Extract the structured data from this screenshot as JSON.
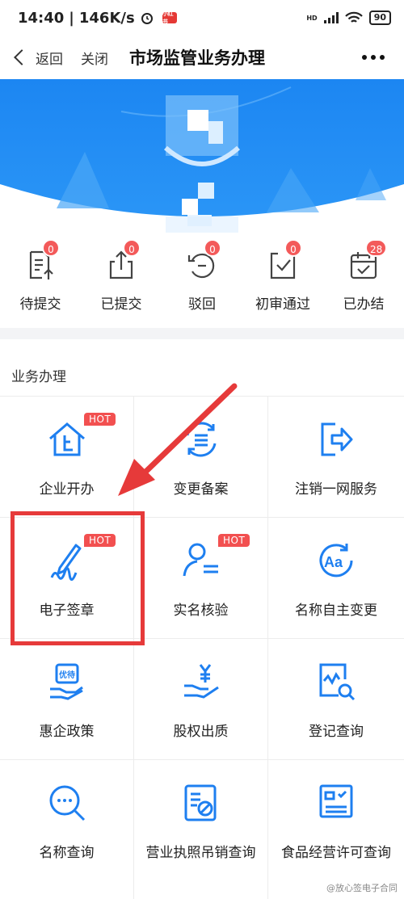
{
  "status_bar": {
    "time": "14:40",
    "network_speed": "146K/s",
    "app_badge": "小红书",
    "battery": "90",
    "signal_label": "HD"
  },
  "nav": {
    "back_label": "返回",
    "close_label": "关闭",
    "title": "市场监管业务办理"
  },
  "status_items": [
    {
      "label": "待提交",
      "count": "0",
      "icon": "document-upload-icon"
    },
    {
      "label": "已提交",
      "count": "0",
      "icon": "share-upload-icon"
    },
    {
      "label": "驳回",
      "count": "0",
      "icon": "reject-icon"
    },
    {
      "label": "初审通过",
      "count": "0",
      "icon": "check-document-icon"
    },
    {
      "label": "已办结",
      "count": "28",
      "icon": "completed-calendar-icon"
    }
  ],
  "section": {
    "title": "业务办理",
    "hot_label": "HOT",
    "items": [
      {
        "label": "企业开办",
        "icon": "house-icon",
        "hot": true
      },
      {
        "label": "变更备案",
        "icon": "refresh-list-icon",
        "hot": false
      },
      {
        "label": "注销一网服务",
        "icon": "exit-icon",
        "hot": false
      },
      {
        "label": "电子签章",
        "icon": "signature-pen-icon",
        "hot": true
      },
      {
        "label": "实名核验",
        "icon": "user-verify-icon",
        "hot": true
      },
      {
        "label": "名称自主变更",
        "icon": "text-aa-icon",
        "hot": false
      },
      {
        "label": "惠企政策",
        "icon": "coupon-hand-icon",
        "hot": false
      },
      {
        "label": "股权出质",
        "icon": "yen-hand-icon",
        "hot": false
      },
      {
        "label": "登记查询",
        "icon": "document-search-icon",
        "hot": false
      },
      {
        "label": "名称查询",
        "icon": "search-dots-icon",
        "hot": false
      },
      {
        "label": "营业执照吊销查询",
        "icon": "license-cancel-icon",
        "hot": false
      },
      {
        "label": "食品经营许可查询",
        "icon": "food-license-icon",
        "hot": false
      }
    ],
    "coupon_text": "优待"
  },
  "watermark": "@放心签电子合同",
  "colors": {
    "primary_blue": "#1e7ff0",
    "badge_red": "#f35a5a",
    "highlight_red": "#e63a3a"
  }
}
